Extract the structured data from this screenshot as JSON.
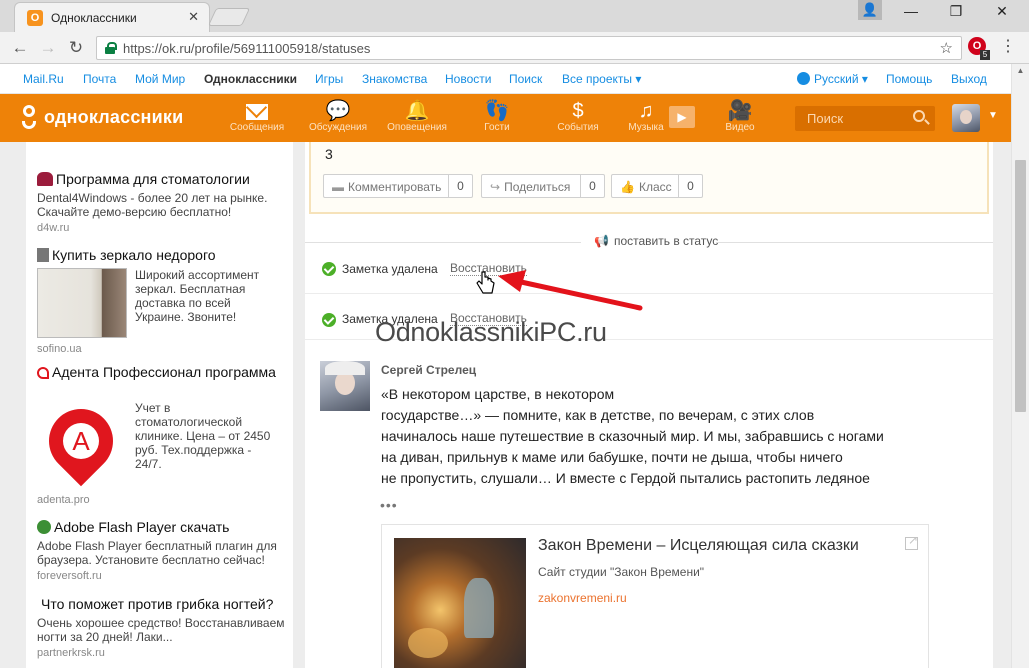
{
  "browser": {
    "tab_title": "Одноклассники",
    "tab_close": "✕",
    "url": "https://ok.ru/profile/569111005918/statuses",
    "ext_badge": "5"
  },
  "portal": {
    "links": [
      "Mail.Ru",
      "Почта",
      "Мой Мир",
      "Одноклассники",
      "Игры",
      "Знакомства",
      "Новости",
      "Поиск",
      "Все проекты ▾"
    ],
    "language": "Русский ▾",
    "help": "Помощь",
    "logout": "Выход"
  },
  "ok_header": {
    "logo_text": "одноклассники",
    "nav": [
      {
        "label": "Сообщения",
        "icon": "envelope-icon"
      },
      {
        "label": "Обсуждения",
        "icon": "chat-bubbles-icon"
      },
      {
        "label": "Оповещения",
        "icon": "bell-icon"
      },
      {
        "label": "Гости",
        "icon": "footprints-icon"
      },
      {
        "label": "События",
        "icon": "events-icon"
      },
      {
        "label": "Музыка",
        "icon": "music-note-icon"
      },
      {
        "label": "Видео",
        "icon": "video-camera-icon"
      }
    ],
    "search_placeholder": "Поиск",
    "brand_color": "#ee8208"
  },
  "ads": [
    {
      "title": "Программа для стоматологии",
      "text": "Dental4Windows - более 20 лет на рынке. Скачайте демо-версию бесплатно!",
      "domain": "d4w.ru"
    },
    {
      "title": "Купить зеркало недорого",
      "text": "Широкий ассортимент зеркал. Бесплатная доставка по всей Украине. Звоните!",
      "domain": "sofino.ua"
    },
    {
      "title": "Адента Профессионал программа",
      "text": "Учет в стоматологической клинике. Цена – от 2450 руб. Тех.поддержка - 24/7.",
      "domain": "adenta.pro",
      "logo_letter": "A"
    },
    {
      "title": "Adobe Flash Player скачать",
      "text": "Adobe Flash Player бесплатный плагин для браузера. Установите бесплатно сейчас!",
      "domain": "foreversoft.ru"
    },
    {
      "title": "Что поможет против грибка ногтей?",
      "text": "Очень хорошее средство! Восстанавливаем ногти за 20 дней! Лаки...",
      "domain": "partnerkrsk.ru"
    }
  ],
  "feed": {
    "top_card": {
      "number": "3",
      "actions": [
        {
          "label": "Комментировать",
          "count": "0",
          "icon": "comment-icon"
        },
        {
          "label": "Поделиться",
          "count": "0",
          "icon": "share-icon"
        },
        {
          "label": "Класс",
          "count": "0",
          "icon": "like-icon"
        }
      ]
    },
    "post_status_label": "поставить в статус",
    "deleted_rows": [
      {
        "text": "Заметка удалена",
        "restore": "Восстановить"
      },
      {
        "text": "Заметка удалена",
        "restore": "Восстановить"
      }
    ],
    "watermark": "OdnoklassnikiPC.ru",
    "post": {
      "author": "Сергей Стрелец",
      "lines": [
        "«В некотором царстве, в некотором",
        "государстве…» — помните, как в детстве, по вечерам, с этих слов",
        "начиналось наше путешествие в сказочный мир. И мы, забравшись с ногами",
        "на диван, прильнув к маме или бабушке, почти не дыша, чтобы ничего",
        "не пропустить, слушали… И вместе с Гердой пытались растопить ледяное"
      ],
      "more": "•••",
      "link": {
        "title": "Закон Времени – Исцеляющая сила сказки",
        "subtitle": "Сайт студии \"Закон Времени\"",
        "domain": "zakonvremeni.ru"
      }
    }
  }
}
